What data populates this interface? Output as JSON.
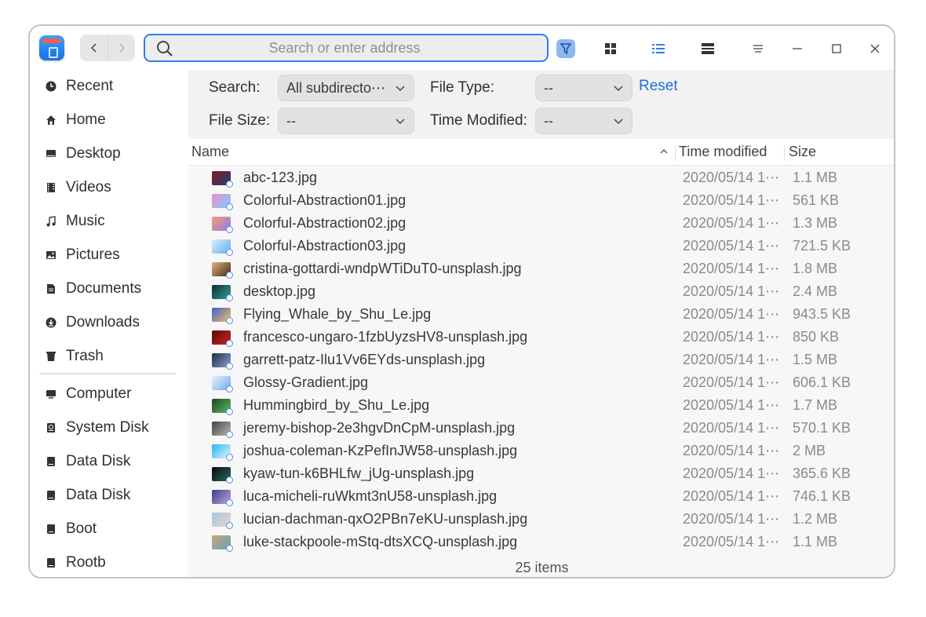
{
  "toolbar": {
    "address_placeholder": "Search or enter address",
    "back_icon": "chevron-left-icon",
    "forward_icon": "chevron-right-icon"
  },
  "sidebar": {
    "items": [
      {
        "label": "Recent",
        "icon": "clock-icon"
      },
      {
        "label": "Home",
        "icon": "home-icon"
      },
      {
        "label": "Desktop",
        "icon": "desktop-icon"
      },
      {
        "label": "Videos",
        "icon": "film-icon"
      },
      {
        "label": "Music",
        "icon": "music-note-icon"
      },
      {
        "label": "Pictures",
        "icon": "image-icon"
      },
      {
        "label": "Documents",
        "icon": "document-icon"
      },
      {
        "label": "Downloads",
        "icon": "download-icon"
      },
      {
        "label": "Trash",
        "icon": "trash-icon"
      }
    ],
    "devices": [
      {
        "label": "Computer",
        "icon": "computer-icon"
      },
      {
        "label": "System Disk",
        "icon": "system-disk-icon"
      },
      {
        "label": "Data Disk",
        "icon": "disk-icon"
      },
      {
        "label": "Data Disk",
        "icon": "disk-icon"
      },
      {
        "label": "Boot",
        "icon": "disk-icon"
      },
      {
        "label": "Rootb",
        "icon": "disk-icon"
      }
    ]
  },
  "filters": {
    "search_label": "Search:",
    "search_value": "All subdirecto⋯",
    "file_type_label": "File Type:",
    "file_type_value": "--",
    "reset_label": "Reset",
    "file_size_label": "File Size:",
    "file_size_value": "--",
    "time_modified_label": "Time Modified:",
    "time_modified_value": "--"
  },
  "columns": {
    "name": "Name",
    "time_modified": "Time modified",
    "size": "Size"
  },
  "files": [
    {
      "name": "abc-123.jpg",
      "date": "2020/05/14 1⋯",
      "size": "1.1 MB",
      "thumb": [
        "#7a1f2b",
        "#2a3a6b"
      ]
    },
    {
      "name": "Colorful-Abstraction01.jpg",
      "date": "2020/05/14 1⋯",
      "size": "561 KB",
      "thumb": [
        "#f08bd0",
        "#7bd1f5"
      ]
    },
    {
      "name": "Colorful-Abstraction02.jpg",
      "date": "2020/05/14 1⋯",
      "size": "1.3 MB",
      "thumb": [
        "#ff9a6b",
        "#8a7cf5"
      ]
    },
    {
      "name": "Colorful-Abstraction03.jpg",
      "date": "2020/05/14 1⋯",
      "size": "721.5 KB",
      "thumb": [
        "#d9ecff",
        "#5fb0f0"
      ]
    },
    {
      "name": "cristina-gottardi-wndpWTiDuT0-unsplash.jpg",
      "date": "2020/05/14 1⋯",
      "size": "1.8 MB",
      "thumb": [
        "#e8b27a",
        "#3b2a20"
      ]
    },
    {
      "name": "desktop.jpg",
      "date": "2020/05/14 1⋯",
      "size": "2.4 MB",
      "thumb": [
        "#0f2b33",
        "#2fa29a"
      ]
    },
    {
      "name": "Flying_Whale_by_Shu_Le.jpg",
      "date": "2020/05/14 1⋯",
      "size": "943.5 KB",
      "thumb": [
        "#3a5fd8",
        "#f5c35a"
      ]
    },
    {
      "name": "francesco-ungaro-1fzbUyzsHV8-unsplash.jpg",
      "date": "2020/05/14 1⋯",
      "size": "850 KB",
      "thumb": [
        "#5a0a0a",
        "#d0241e"
      ]
    },
    {
      "name": "garrett-patz-Ilu1Vv6EYds-unsplash.jpg",
      "date": "2020/05/14 1⋯",
      "size": "1.5 MB",
      "thumb": [
        "#1c2a4a",
        "#8aa4d0"
      ]
    },
    {
      "name": "Glossy-Gradient.jpg",
      "date": "2020/05/14 1⋯",
      "size": "606.1 KB",
      "thumb": [
        "#e6f2ff",
        "#6fa8e8"
      ]
    },
    {
      "name": "Hummingbird_by_Shu_Le.jpg",
      "date": "2020/05/14 1⋯",
      "size": "1.7 MB",
      "thumb": [
        "#1d4a2a",
        "#5fb85a"
      ]
    },
    {
      "name": "jeremy-bishop-2e3hgvDnCpM-unsplash.jpg",
      "date": "2020/05/14 1⋯",
      "size": "570.1 KB",
      "thumb": [
        "#3a4450",
        "#c7b8a0"
      ]
    },
    {
      "name": "joshua-coleman-KzPefInJW58-unsplash.jpg",
      "date": "2020/05/14 1⋯",
      "size": "2 MB",
      "thumb": [
        "#27b5e8",
        "#e6f7ff"
      ]
    },
    {
      "name": "kyaw-tun-k6BHLfw_jUg-unsplash.jpg",
      "date": "2020/05/14 1⋯",
      "size": "365.6 KB",
      "thumb": [
        "#050a10",
        "#2b6a5a"
      ]
    },
    {
      "name": "luca-micheli-ruWkmt3nU58-unsplash.jpg",
      "date": "2020/05/14 1⋯",
      "size": "746.1 KB",
      "thumb": [
        "#3a3e8a",
        "#c0a6d8"
      ]
    },
    {
      "name": "lucian-dachman-qxO2PBn7eKU-unsplash.jpg",
      "date": "2020/05/14 1⋯",
      "size": "1.2 MB",
      "thumb": [
        "#a8c4e0",
        "#e8d8c8"
      ]
    },
    {
      "name": "luke-stackpoole-mStq-dtsXCQ-unsplash.jpg",
      "date": "2020/05/14 1⋯",
      "size": "1.1 MB",
      "thumb": [
        "#c8a878",
        "#6aa0b8"
      ]
    }
  ],
  "status": {
    "item_count": "25 items"
  },
  "colors": {
    "accent": "#2d7df0",
    "link": "#1f6fd8"
  }
}
